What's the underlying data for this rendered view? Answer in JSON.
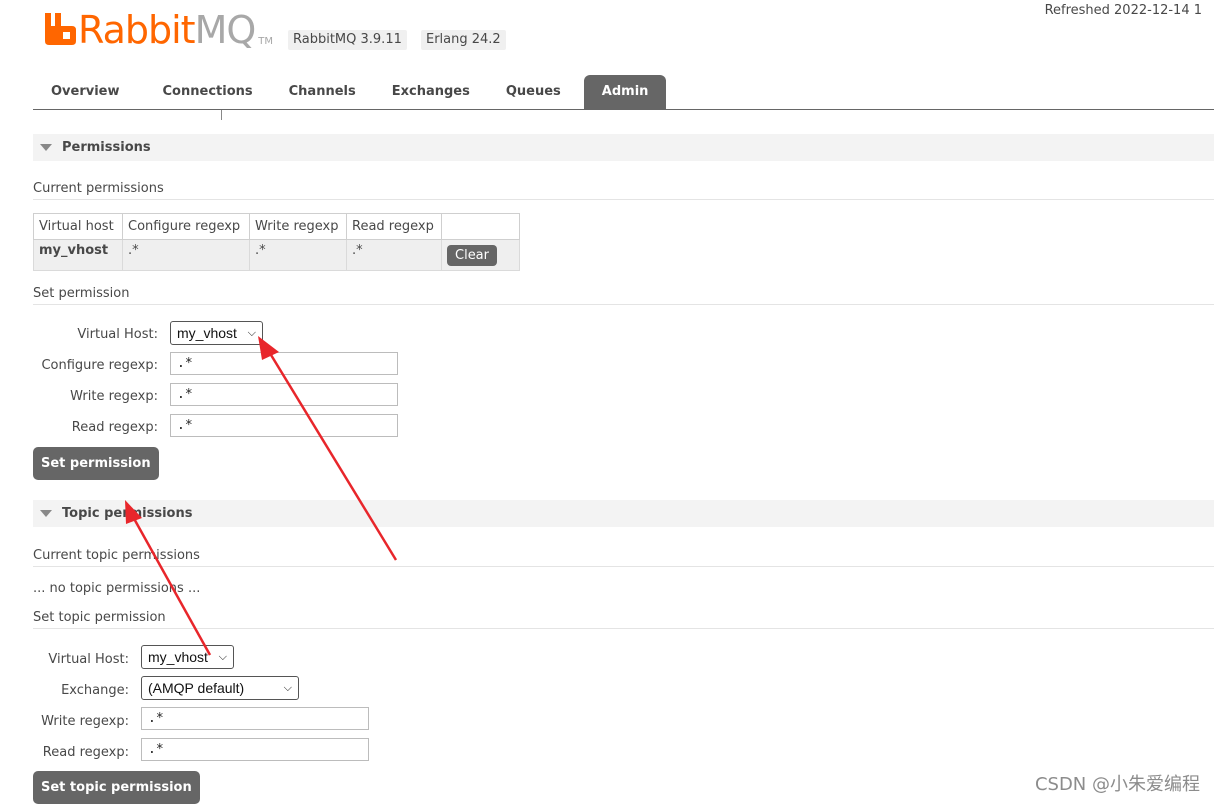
{
  "header": {
    "logo_rabbit": "Rabbit",
    "logo_mq": "MQ",
    "logo_tm": "TM",
    "rabbitmq_version": "RabbitMQ 3.9.11",
    "erlang_version": "Erlang 24.2",
    "refreshed": "Refreshed 2022-12-14 1"
  },
  "tabs": [
    {
      "label": "Overview"
    },
    {
      "label": "Connections"
    },
    {
      "label": "Channels"
    },
    {
      "label": "Exchanges"
    },
    {
      "label": "Queues"
    },
    {
      "label": "Admin",
      "active": true
    }
  ],
  "permissions": {
    "title": "Permissions",
    "current_heading": "Current permissions",
    "columns": [
      "Virtual host",
      "Configure regexp",
      "Write regexp",
      "Read regexp",
      ""
    ],
    "rows": [
      {
        "vhost": "my_vhost",
        "configure": ".*",
        "write": ".*",
        "read": ".*",
        "action": "Clear"
      }
    ],
    "set_heading": "Set permission",
    "form": {
      "vhost_label": "Virtual Host:",
      "vhost_value": "my_vhost",
      "configure_label": "Configure regexp:",
      "configure_value": ".*",
      "write_label": "Write regexp:",
      "write_value": ".*",
      "read_label": "Read regexp:",
      "read_value": ".*",
      "submit": "Set permission"
    }
  },
  "topic_permissions": {
    "title": "Topic permissions",
    "current_heading": "Current topic permissions",
    "empty_text": "... no topic permissions ...",
    "set_heading": "Set topic permission",
    "form": {
      "vhost_label": "Virtual Host:",
      "vhost_value": "my_vhost",
      "exchange_label": "Exchange:",
      "exchange_value": "(AMQP default)",
      "write_label": "Write regexp:",
      "write_value": ".*",
      "read_label": "Read regexp:",
      "read_value": ".*",
      "submit": "Set topic permission"
    }
  },
  "watermark": "CSDN @小朱爱编程",
  "colors": {
    "brand_orange": "#ff6600",
    "tab_active": "#666666",
    "annotation_arrow": "#e8262b"
  }
}
